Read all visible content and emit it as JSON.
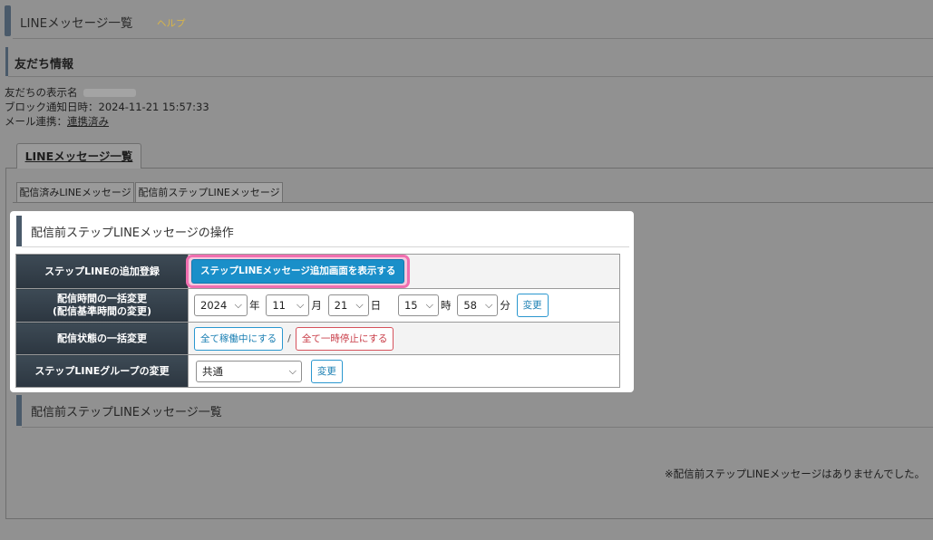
{
  "header": {
    "title": "LINEメッセージ一覧",
    "help": "ヘルプ"
  },
  "friend_section": {
    "title": "友だち情報",
    "display_name_label": "友だちの表示名",
    "block_label": "ブロック通知日時：2024-11-21 15:57:33",
    "mail_label": "メール連携：",
    "mail_value": "連携済み"
  },
  "tabs": {
    "main": "LINEメッセージ一覧"
  },
  "subtabs": [
    "配信済みLINEメッセージ",
    "配信前ステップLINEメッセージ"
  ],
  "operations": {
    "title": "配信前ステップLINEメッセージの操作",
    "rows": {
      "add": {
        "label": "ステップLINEの追加登録",
        "button": "ステップLINEメッセージ追加画面を表示する"
      },
      "time": {
        "label_line1": "配信時間の一括変更",
        "label_line2": "(配信基準時間の変更)",
        "year": "2024",
        "year_unit": "年",
        "month": "11",
        "month_unit": "月",
        "day": "21",
        "day_unit": "日",
        "hour": "15",
        "hour_unit": "時",
        "minute": "58",
        "minute_unit": "分",
        "change": "変更"
      },
      "status": {
        "label": "配信状態の一括変更",
        "activate": "全て稼働中にする",
        "separator": "/",
        "pause": "全て一時停止にする"
      },
      "group": {
        "label": "ステップLINEグループの変更",
        "value": "共通",
        "change": "変更"
      }
    }
  },
  "list": {
    "title": "配信前ステップLINEメッセージ一覧",
    "empty": "※配信前ステップLINEメッセージはありませんでした。"
  },
  "colors": {
    "primary": "#1a8fc9",
    "highlight": "#f06fb0",
    "danger": "#c93d48",
    "header_dark": "#2c3640"
  }
}
